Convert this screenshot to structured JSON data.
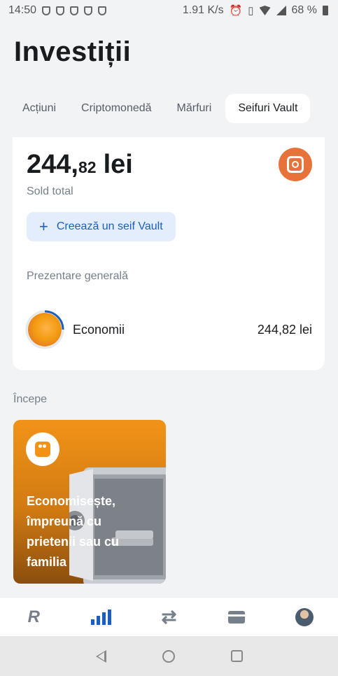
{
  "status_bar": {
    "time": "14:50",
    "network_speed": "1.91 K/s",
    "battery": "68 %",
    "icons": [
      "shield-icon",
      "shield-icon",
      "shield-icon",
      "shield-icon",
      "shield-icon",
      "alarm-icon",
      "vibrate-icon",
      "wifi-icon",
      "signal-icon",
      "battery-icon"
    ]
  },
  "header": {
    "title": "Investiții"
  },
  "tabs": [
    {
      "label": "Acțiuni",
      "active": false
    },
    {
      "label": "Criptomonedă",
      "active": false
    },
    {
      "label": "Mărfuri",
      "active": false
    },
    {
      "label": "Seifuri Vault",
      "active": true
    }
  ],
  "vault_card": {
    "balance_int": "244,",
    "balance_dec": "82",
    "currency": "lei",
    "balance_label": "Sold total",
    "badge_icon": "vault-icon",
    "create_button": {
      "icon": "plus-icon",
      "label": "Creează un seif Vault"
    },
    "overview_label": "Prezentare generală",
    "pockets": [
      {
        "name": "Economii",
        "amount": "244,82 lei"
      }
    ]
  },
  "start_section": {
    "label": "Începe",
    "promo": {
      "icon": "group-icon",
      "text": "Economisește, împreună cu prietenii sau cu familia"
    }
  },
  "bottom_nav": [
    "home-icon",
    "investments-icon",
    "transfers-icon",
    "cards-icon",
    "profile-avatar"
  ],
  "colors": {
    "accent": "#1a5fbf",
    "vault_badge": "#e8733a",
    "promo": "#f29318"
  }
}
